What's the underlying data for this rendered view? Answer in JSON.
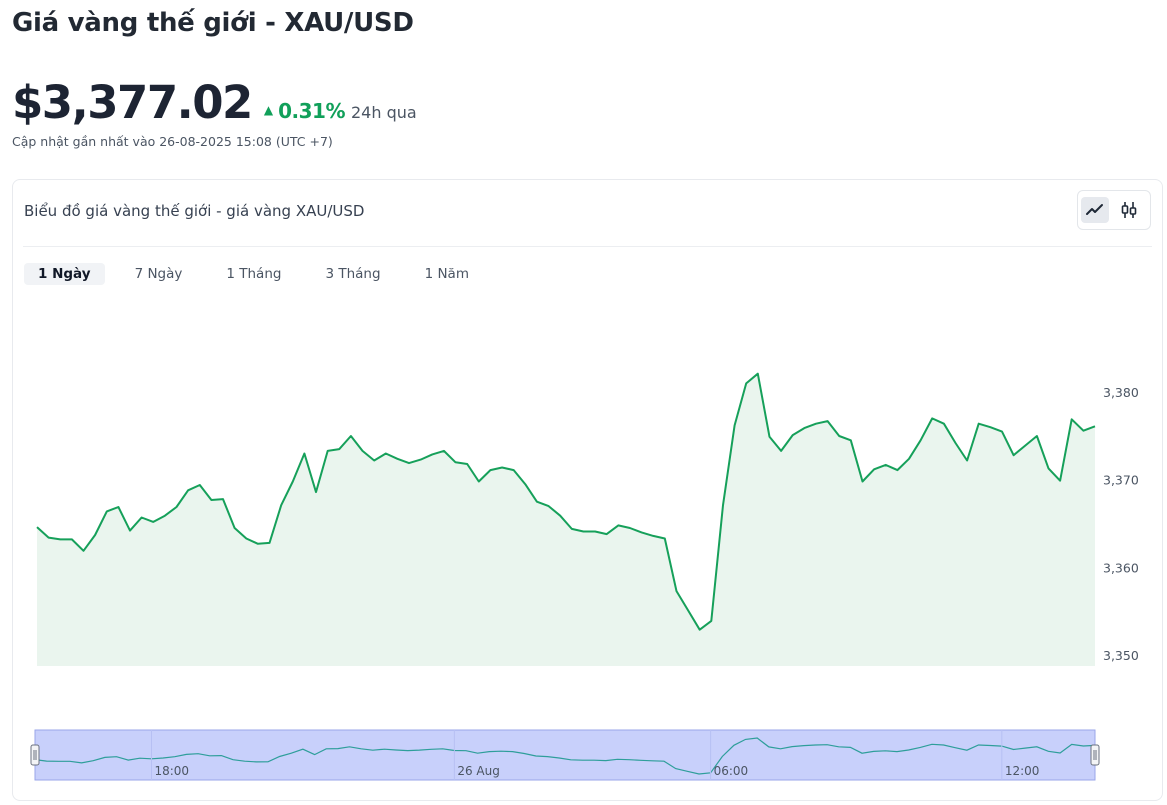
{
  "header": {
    "title": "Giá vàng thế giới - XAU/USD",
    "price": "$3,377.02",
    "change_arrow": "▲",
    "change_pct": "0.31%",
    "change_period": "24h qua",
    "updated": "Cập nhật gần nhất vào 26-08-2025 15:08 (UTC +7)"
  },
  "card": {
    "title": "Biểu đồ giá vàng thế giới - giá vàng XAU/USD",
    "view_modes": [
      {
        "name": "line",
        "icon": "line-chart-icon",
        "active": true
      },
      {
        "name": "candlestick",
        "icon": "candlestick-icon",
        "active": false
      }
    ],
    "tabs": [
      {
        "label": "1 Ngày",
        "active": true
      },
      {
        "label": "7 Ngày",
        "active": false
      },
      {
        "label": "1 Tháng",
        "active": false
      },
      {
        "label": "3 Tháng",
        "active": false
      },
      {
        "label": "1 Năm",
        "active": false
      }
    ]
  },
  "colors": {
    "up": "#11a05a",
    "line": "#16a05a",
    "area": "#eaf5ee",
    "navigator_bg": "#c8d0fb",
    "navigator_line": "#2e9e9a"
  },
  "chart_data": {
    "type": "area",
    "series": [
      {
        "values": [
          3364.7,
          3363.5,
          3363.3,
          3363.3,
          3362.0,
          3363.8,
          3366.5,
          3367.0,
          3364.3,
          3365.8,
          3365.3,
          3366.0,
          3367.0,
          3368.9,
          3369.5,
          3367.8,
          3367.9,
          3364.6,
          3363.4,
          3362.8,
          3362.9,
          3367.2,
          3369.9,
          3373.1,
          3368.7,
          3373.4,
          3373.6,
          3375.1,
          3373.4,
          3372.3,
          3373.1,
          3372.5,
          3372.0,
          3372.4,
          3373.0,
          3373.4,
          3372.1,
          3371.9,
          3369.9,
          3371.2,
          3371.5,
          3371.2,
          3369.6,
          3367.6,
          3367.1,
          3366.0,
          3364.5,
          3364.2,
          3364.2,
          3363.9,
          3364.9,
          3364.6,
          3364.1,
          3363.7,
          3363.4,
          3357.4,
          3355.2,
          3353.0,
          3354.0,
          3367.2,
          3376.3,
          3381.1,
          3382.2,
          3375.0,
          3373.4,
          3375.2,
          3376.0,
          3376.5,
          3376.8,
          3375.1,
          3374.6,
          3369.9,
          3371.3,
          3371.8,
          3371.2,
          3372.5,
          3374.6,
          3377.1,
          3376.5,
          3374.3,
          3372.3,
          3376.5,
          3376.1,
          3375.6,
          3372.9,
          3374.0,
          3375.1,
          3371.4,
          3370.0,
          3377.0,
          3375.7,
          3376.2
        ]
      }
    ],
    "y_ticks": [
      3350,
      3360,
      3370,
      3380
    ],
    "y_tick_labels": [
      "3,350",
      "3,360",
      "3,370",
      "3,380"
    ],
    "ylim": [
      3349,
      3386
    ],
    "navigator_labels": [
      "18:00",
      "26 Aug",
      "06:00",
      "12:00"
    ],
    "navigator_label_index": [
      10,
      36,
      58,
      83
    ],
    "grid": false
  }
}
